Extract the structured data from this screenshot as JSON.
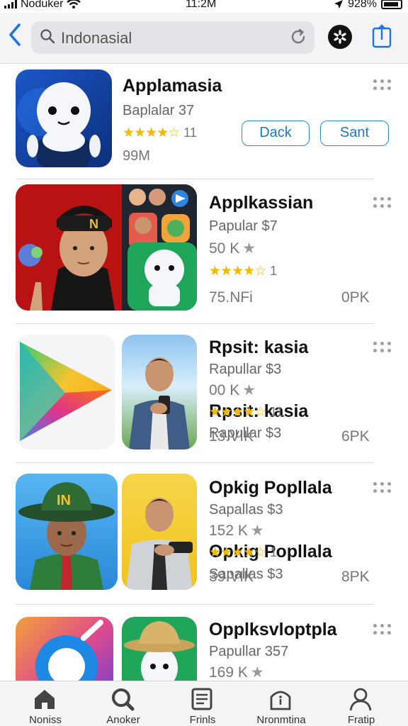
{
  "status_bar": {
    "carrier": "Noduker",
    "time": "11:2M",
    "battery": "928%"
  },
  "search": {
    "query": "Indonasial"
  },
  "apps": [
    {
      "name": "Applamasia",
      "subtitle": "Baplalar 37",
      "rating_count": "11",
      "size": "99M",
      "buttons": [
        "Dack",
        "Sant"
      ]
    },
    {
      "name": "Applkassian",
      "subtitle": "Papular $7",
      "downloads": "50 K",
      "rating_count": "1",
      "stat_left": "75.NFi",
      "stat_right": "0PK"
    },
    {
      "name": "Rpsit: kasia",
      "subtitle": "Rapullar $3",
      "downloads": "00 K",
      "rating_count": "11",
      "stat_left": "13.VIK",
      "stat_right": "6PK"
    },
    {
      "name": "Opkig Popllala",
      "subtitle": "Sapallas $3",
      "downloads": "152 K",
      "rating_count": "1",
      "stat_left": "39.VIK",
      "stat_right": "8PK"
    },
    {
      "name": "Opplksvloptpla",
      "subtitle": "Papullar 357",
      "downloads": "169 K"
    }
  ],
  "tile_badges": {
    "hat_text": "N",
    "cap_text": "IN"
  },
  "tabs": [
    {
      "label": "Noniss",
      "icon": "home-icon"
    },
    {
      "label": "Anoker",
      "icon": "search-icon"
    },
    {
      "label": "Frinls",
      "icon": "document-icon"
    },
    {
      "label": "Nronmtina",
      "icon": "archive-icon"
    },
    {
      "label": "Fratip",
      "icon": "profile-icon"
    }
  ],
  "colors": {
    "accent": "#1a73e8",
    "star": "#f5b800",
    "button_border": "#2b8fd1"
  }
}
